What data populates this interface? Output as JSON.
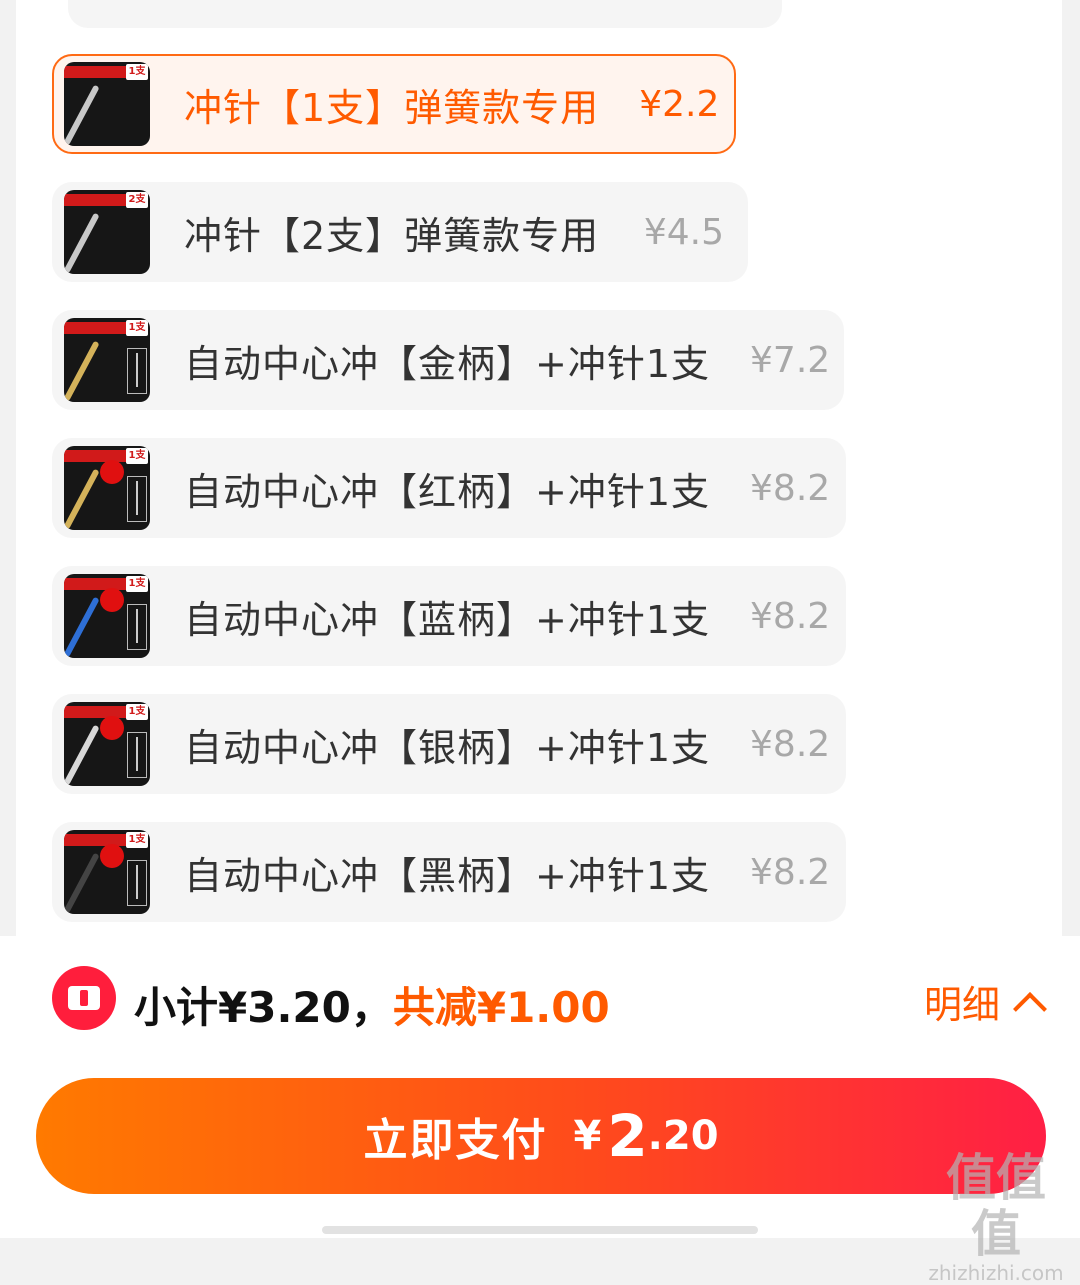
{
  "options": [
    {
      "thumb_tag": "中心冲顶针",
      "qty_badge": "1支",
      "label": "冲针【1支】弹簧款专用",
      "price": "¥2.2",
      "selected": true,
      "rod_color": "#c8c8c8"
    },
    {
      "thumb_tag": "中心冲顶针",
      "qty_badge": "2支",
      "label": "冲针【2支】弹簧款专用",
      "price": "¥4.5",
      "selected": false,
      "rod_color": "#c8c8c8"
    },
    {
      "thumb_tag": "自动中心冲",
      "qty_badge": "1支",
      "label": "自动中心冲【金柄】+冲针1支",
      "price": "¥7.2",
      "selected": false,
      "rod_color": "#d4b25a"
    },
    {
      "thumb_tag": "自动中心冲",
      "qty_badge": "1支",
      "label": "自动中心冲【红柄】+冲针1支",
      "price": "¥8.2",
      "selected": false,
      "rod_color": "#d4b25a"
    },
    {
      "thumb_tag": "自动中心冲",
      "qty_badge": "1支",
      "label": "自动中心冲【蓝柄】+冲针1支",
      "price": "¥8.2",
      "selected": false,
      "rod_color": "#2e6fd6"
    },
    {
      "thumb_tag": "自动中心冲",
      "qty_badge": "1支",
      "label": "自动中心冲【银柄】+冲针1支",
      "price": "¥8.2",
      "selected": false,
      "rod_color": "#d8d8d8"
    },
    {
      "thumb_tag": "自动中心冲",
      "qty_badge": "1支",
      "label": "自动中心冲【黑柄】+冲针1支",
      "price": "¥8.2",
      "selected": false,
      "rod_color": "#444444"
    }
  ],
  "footer": {
    "subtotal_text": "小计¥3.20，",
    "discount_text": "共减¥1.00",
    "detail_label": "明细",
    "pay_label": "立即支付",
    "pay_yen": "¥",
    "pay_int": "2",
    "pay_dec": ".20"
  },
  "watermark": {
    "main": "值值值",
    "sub": "zhizhizhi.com"
  },
  "colors": {
    "accent": "#ff5a00",
    "button_start": "#ff7a00",
    "button_end": "#ff1f45"
  }
}
